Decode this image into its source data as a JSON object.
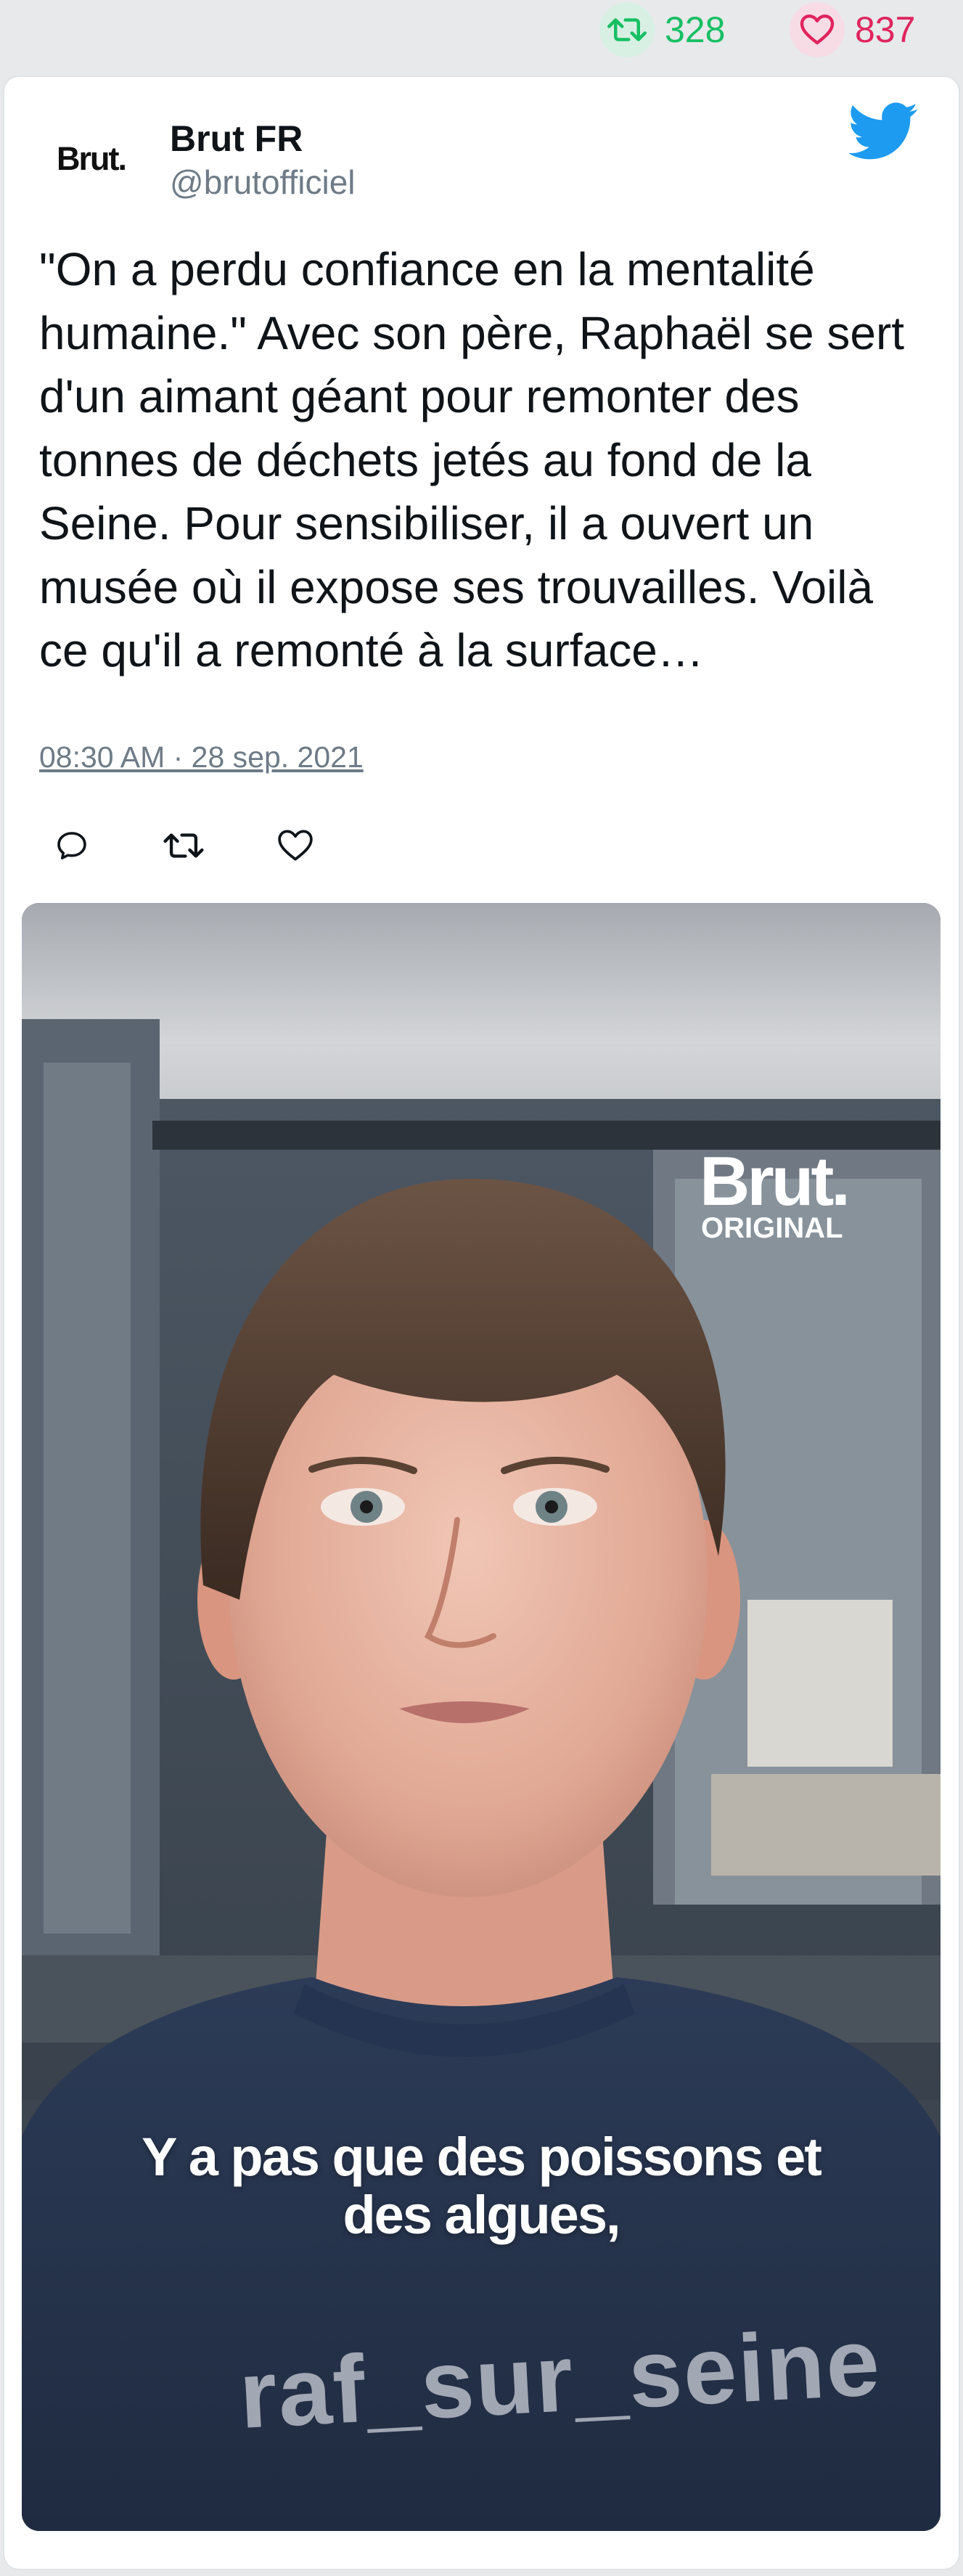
{
  "previous_tweet": {
    "retweet_count": "328",
    "like_count": "837"
  },
  "tweet": {
    "author": {
      "logo_text": "Brut.",
      "name": "Brut FR",
      "handle": "@brutofficiel"
    },
    "text": "\"On a perdu confiance en la mentalité humaine.\" Avec son père, Raphaël se sert d'un aimant géant pour remonter des tonnes de déchets jetés au fond de la Seine. Pour sensibiliser, il a ouvert un musée où il expose ses trouvailles. Voilà ce qu'il a remonté à la surface…",
    "timestamp": "08:30 AM · 28 sep. 2021",
    "actions": [
      "reply",
      "retweet",
      "like"
    ]
  },
  "media": {
    "brand_word": "Brut.",
    "brand_sub": "ORIGINAL",
    "caption_line1": "Y a pas que des poissons et",
    "caption_line2": "des algues,",
    "watermark": "raf_sur_seine"
  },
  "colors": {
    "retweet_green": "#17bf63",
    "like_pink": "#e0245e",
    "twitter_blue": "#1d9bf0",
    "muted_text": "#6e7b87",
    "background": "#e7e9eb"
  },
  "icons": {
    "retweet": "retweet-icon",
    "like": "heart-icon",
    "reply": "reply-icon",
    "brand": "twitter-bird-icon"
  }
}
